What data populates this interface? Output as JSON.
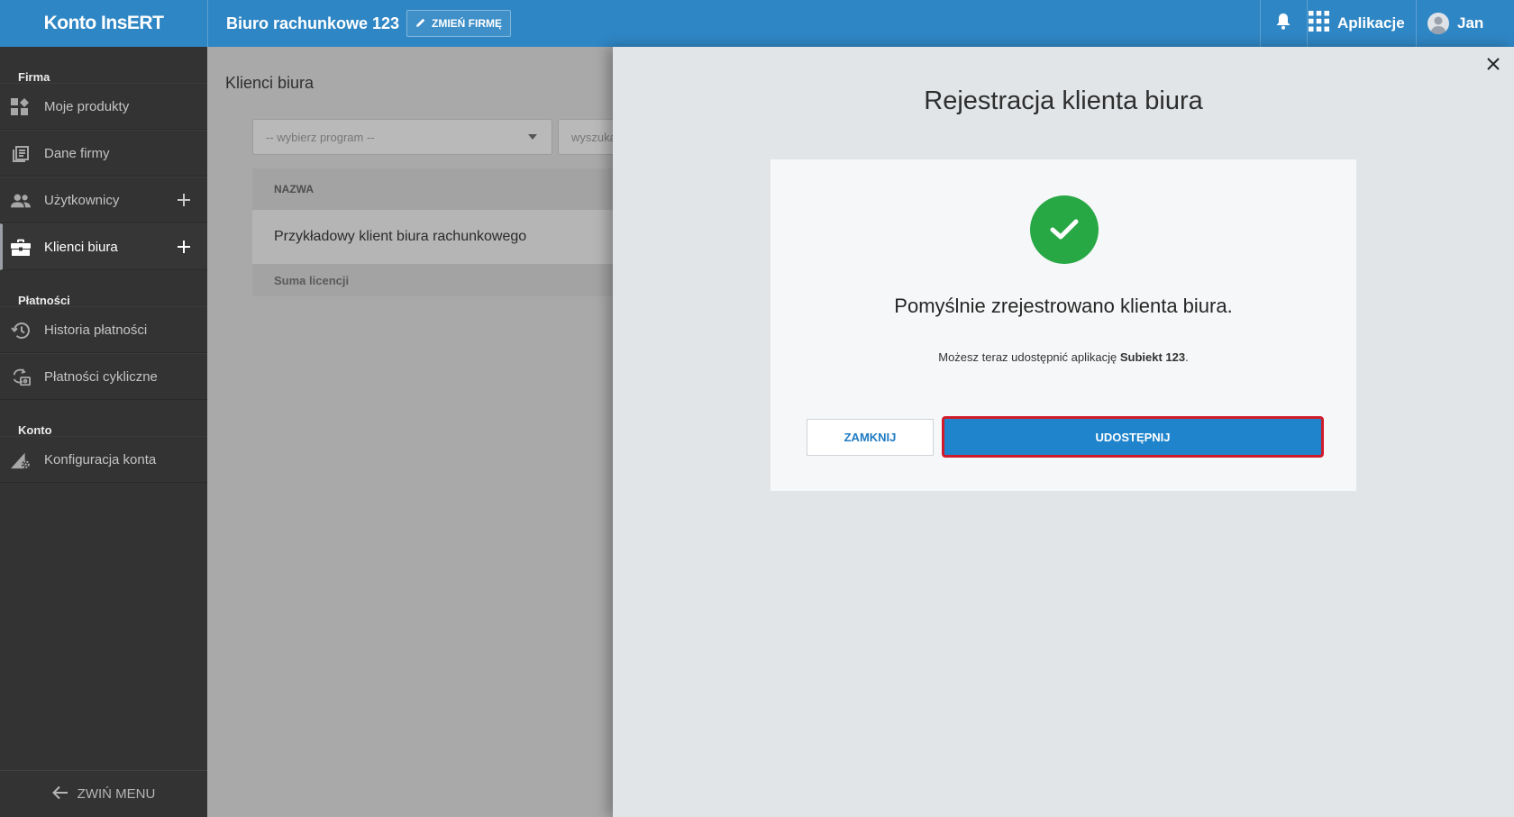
{
  "topbar": {
    "brand": "Konto InsERT",
    "company_name": "Biuro rachunkowe 123",
    "change_company_label": "ZMIEŃ FIRMĘ",
    "apps_label": "Aplikacje",
    "user_name": "Jan",
    "background_color": "#2f86c4"
  },
  "sidebar": {
    "sections": [
      {
        "title": "Firma"
      },
      {
        "title": "Płatności"
      },
      {
        "title": "Konto"
      }
    ],
    "items": [
      {
        "label": "Moje produkty",
        "icon": "products-icon"
      },
      {
        "label": "Dane firmy",
        "icon": "company-data-icon"
      },
      {
        "label": "Użytkownicy",
        "icon": "users-icon"
      },
      {
        "label": "Klienci biura",
        "icon": "briefcase-icon",
        "active": true
      },
      {
        "label": "Historia płatności",
        "icon": "history-icon"
      },
      {
        "label": "Płatności cykliczne",
        "icon": "recurring-payments-icon"
      },
      {
        "label": "Konfiguracja konta",
        "icon": "account-config-icon"
      }
    ],
    "collapse_label": "ZWIŃ MENU"
  },
  "main": {
    "title": "Klienci biura",
    "program_select": {
      "value": "-- wybierz program --"
    },
    "search": {
      "placeholder": "wyszukaj"
    },
    "table": {
      "header": "NAZWA",
      "rows": [
        "Przykładowy klient biura rachunkowego"
      ],
      "footer": "Suma licencji"
    }
  },
  "panel": {
    "title": "Rejestracja klienta biura",
    "success_title": "Pomyślnie zrejestrowano klienta biura.",
    "message_prefix": "Możesz teraz udostępnić aplikację ",
    "message_app": "Subiekt 123",
    "message_suffix": ".",
    "close_label": "ZAMKNIJ",
    "share_label": "UDOSTĘPNIJ",
    "success_color": "#28a745",
    "primary_color": "#1f84cc",
    "highlight_color": "#d01c2a"
  }
}
